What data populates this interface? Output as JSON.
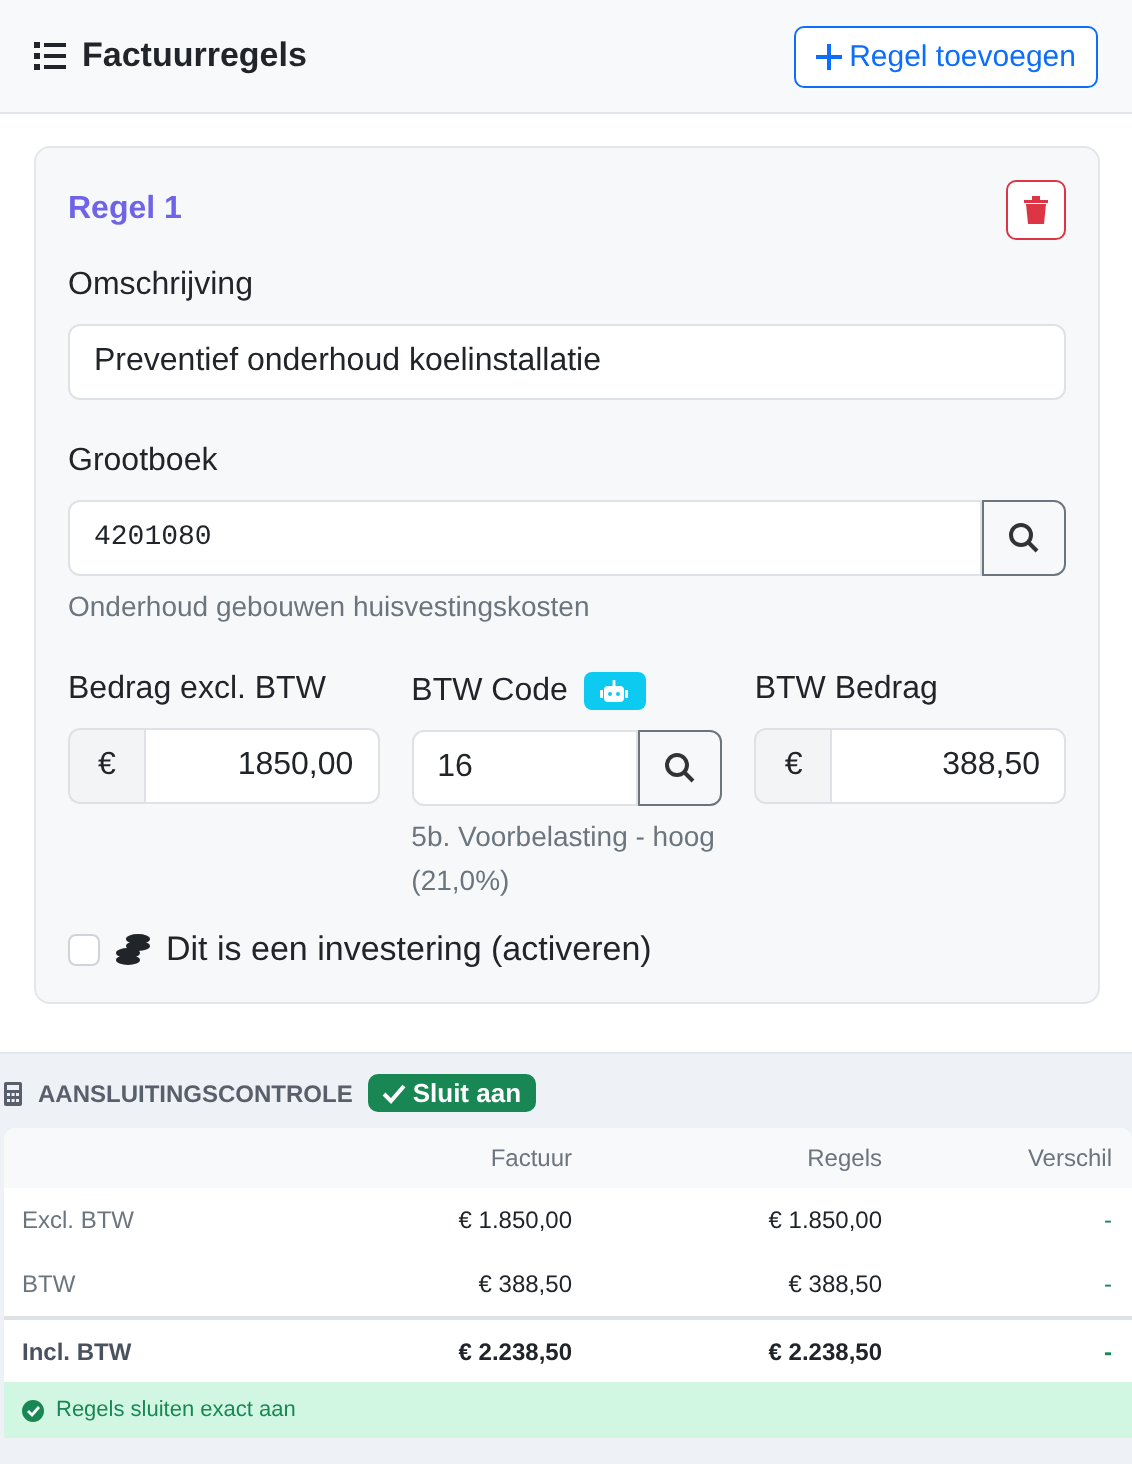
{
  "header": {
    "title": "Factuurregels",
    "add_button": "Regel toevoegen"
  },
  "lines": [
    {
      "title": "Regel 1",
      "description_label": "Omschrijving",
      "description": "Preventief onderhoud koelinstallatie",
      "ledger_label": "Grootboek",
      "ledger": "4201080",
      "ledger_name": "Onderhoud gebouwen huisvestingskosten",
      "amount_label": "Bedrag excl. BTW",
      "currency": "€",
      "amount": "1850,00",
      "vat_code_label": "BTW Code",
      "vat_code": "16",
      "vat_code_name": "5b. Voorbelasting - hoog (21,0%)",
      "vat_amount_label": "BTW Bedrag",
      "vat_currency": "€",
      "vat_amount": "388,50",
      "investment_label": "Dit is een investering (activeren)",
      "investment_checked": false
    }
  ],
  "reconciliation": {
    "title": "AANSLUITINGSCONTROLE",
    "status": "Sluit aan",
    "matched": true,
    "columns": [
      "Factuur",
      "Regels",
      "Verschil"
    ],
    "rows": [
      {
        "kind": "normal",
        "label": "Excl. BTW",
        "invoice": "€ 1.850,00",
        "lines": "€ 1.850,00",
        "difference": "-"
      },
      {
        "kind": "normal",
        "label": "BTW",
        "invoice": "€ 388,50",
        "lines": "€ 388,50",
        "difference": "-"
      },
      {
        "kind": "total",
        "label": "Incl. BTW",
        "invoice": "€ 2.238,50",
        "lines": "€ 2.238,50",
        "difference": "-"
      }
    ],
    "message": "Regels sluiten exact aan"
  }
}
